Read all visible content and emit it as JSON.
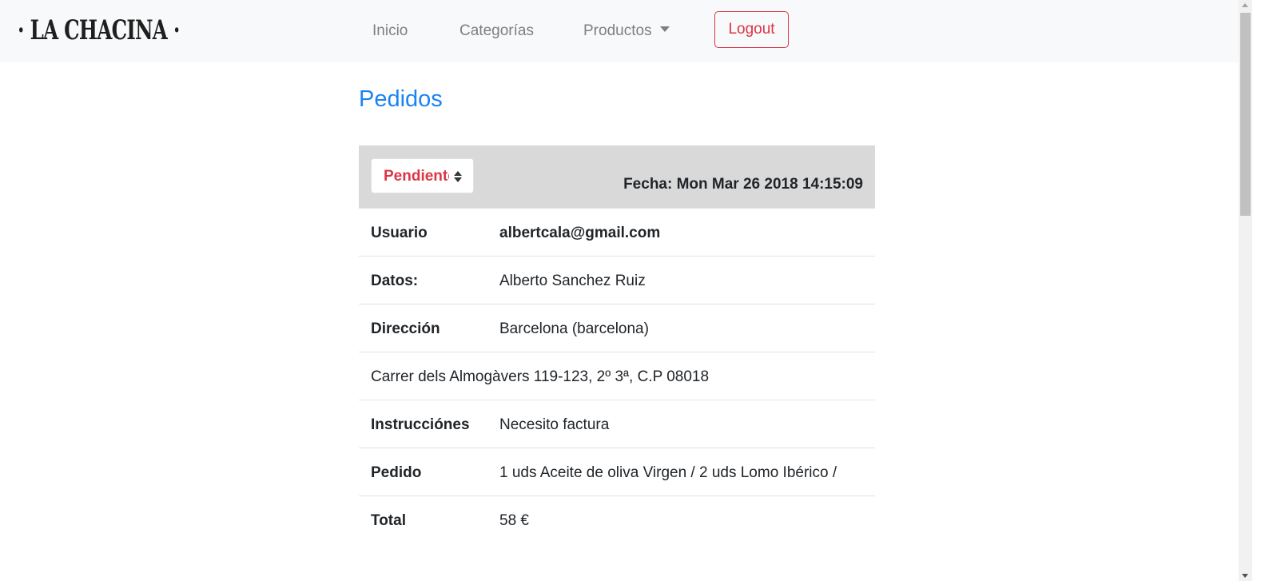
{
  "navbar": {
    "brand": "· LA CHACINA ·",
    "links": [
      {
        "label": "Inicio"
      },
      {
        "label": "Categorías"
      },
      {
        "label": "Productos"
      }
    ],
    "logout_label": "Logout"
  },
  "page": {
    "title": "Pedidos"
  },
  "order": {
    "status": "Pendiente",
    "fecha": "Fecha: Mon Mar 26 2018 14:15:09",
    "usuario_label": "Usuario",
    "usuario_value": "albertcala@gmail.com",
    "datos_label": "Datos:",
    "datos_value": "Alberto Sanchez Ruiz",
    "direccion_label": "Dirección",
    "direccion_value": "Barcelona (barcelona)",
    "direccion_full": "Carrer dels Almogàvers 119-123, 2º 3ª, C.P 08018",
    "instrucciones_label": "Instrucciónes",
    "instrucciones_value": "Necesito factura",
    "pedido_label": "Pedido",
    "pedido_value": "1 uds Aceite de oliva Virgen / 2 uds Lomo Ibérico /",
    "total_label": "Total",
    "total_value": "58 €"
  },
  "colors": {
    "accent": "#1a84f1",
    "danger": "#dc3545",
    "header_bg": "#d9d9d9",
    "navbar_bg": "#f8f9fa"
  },
  "icons": {
    "dropdown": "caret-down-icon",
    "select": "sort-icon"
  }
}
